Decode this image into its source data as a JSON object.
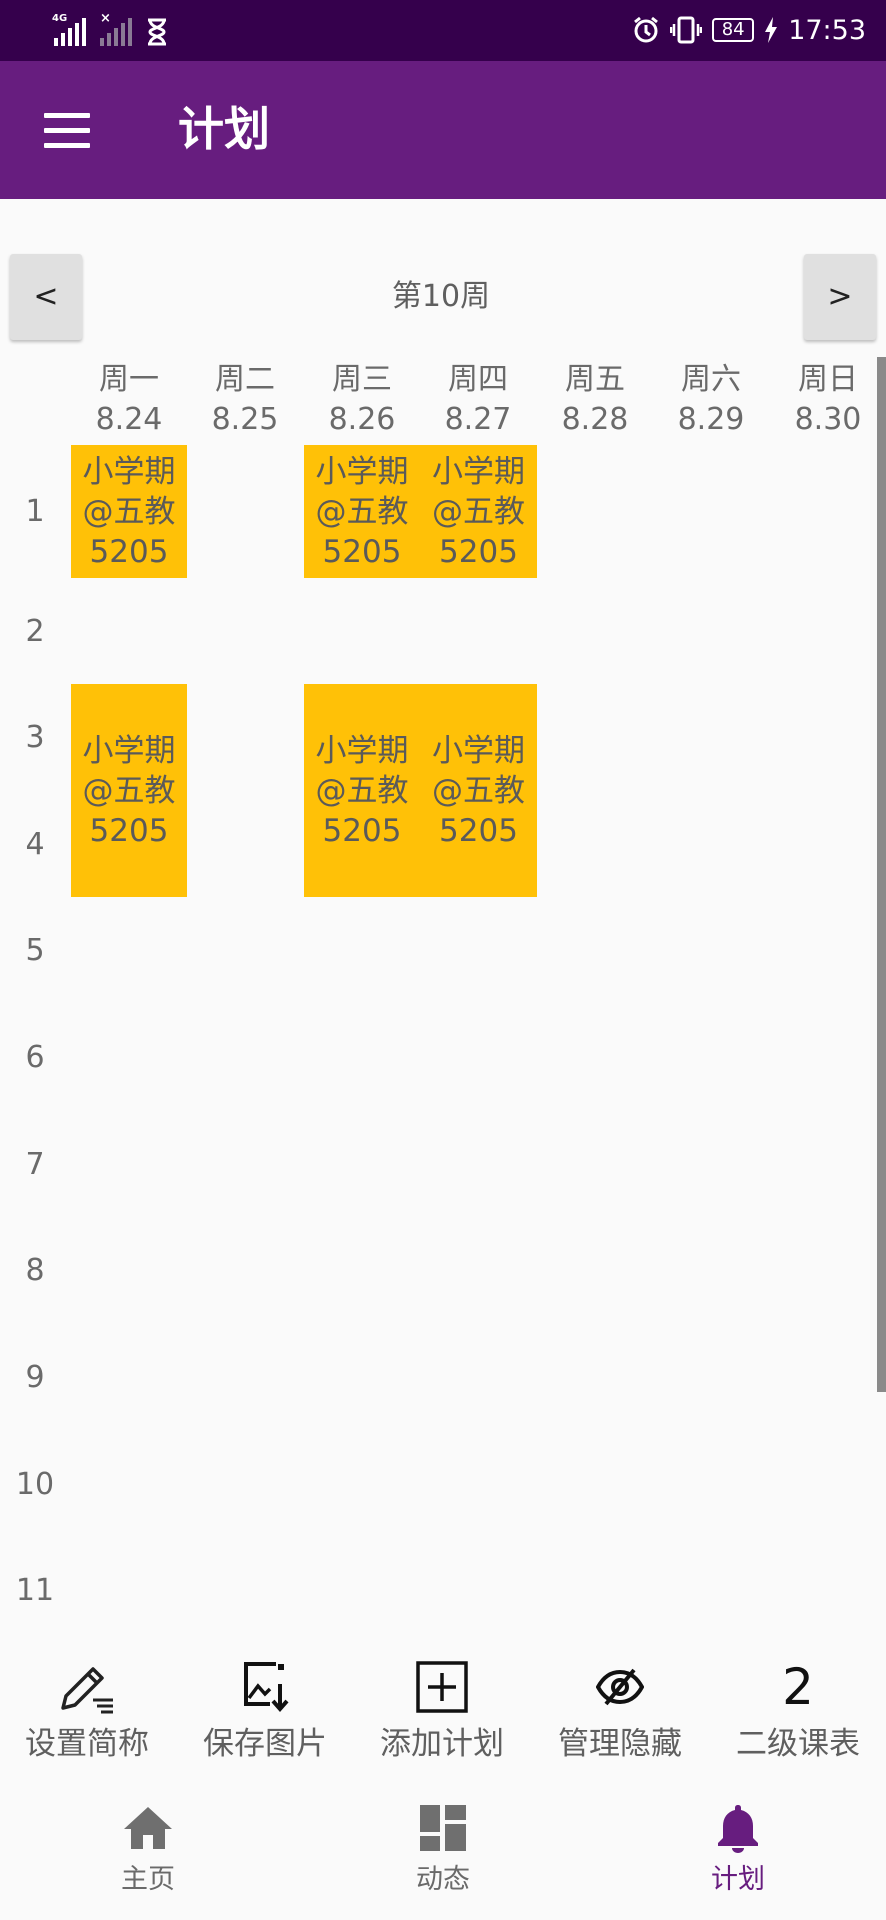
{
  "status_bar": {
    "network_tag": "4G",
    "time": "17:53",
    "battery": "84"
  },
  "app_bar": {
    "title": "计划"
  },
  "week_nav": {
    "prev_label": "<",
    "next_label": ">",
    "week_label": "第10周"
  },
  "days": [
    {
      "weekday": "周一",
      "date": "8.24"
    },
    {
      "weekday": "周二",
      "date": "8.25"
    },
    {
      "weekday": "周三",
      "date": "8.26"
    },
    {
      "weekday": "周四",
      "date": "8.27"
    },
    {
      "weekday": "周五",
      "date": "8.28"
    },
    {
      "weekday": "周六",
      "date": "8.29"
    },
    {
      "weekday": "周日",
      "date": "8.30"
    }
  ],
  "periods": [
    "1",
    "2",
    "3",
    "4",
    "5",
    "6",
    "7",
    "8",
    "9",
    "10",
    "11"
  ],
  "courses": [
    {
      "line1": "小学期",
      "line2": "@五教",
      "line3": "5205"
    },
    {
      "line1": "小学期",
      "line2": "@五教",
      "line3": "5205"
    },
    {
      "line1": "小学期",
      "line2": "@五教",
      "line3": "5205"
    },
    {
      "line1": "小学期",
      "line2": "@五教",
      "line3": "5205"
    },
    {
      "line1": "小学期",
      "line2": "@五教",
      "line3": "5205"
    },
    {
      "line1": "小学期",
      "line2": "@五教",
      "line3": "5205"
    }
  ],
  "toolbar": [
    {
      "label": "设置简称",
      "icon": "edit-icon"
    },
    {
      "label": "保存图片",
      "icon": "save-image-icon"
    },
    {
      "label": "添加计划",
      "icon": "add-box-icon"
    },
    {
      "label": "管理隐藏",
      "icon": "visibility-off-icon"
    },
    {
      "label": "二级课表",
      "icon": "number-two-icon",
      "glyph": "2"
    }
  ],
  "bottom_nav": [
    {
      "label": "主页",
      "icon": "home-icon",
      "active": false
    },
    {
      "label": "动态",
      "icon": "dashboard-icon",
      "active": false
    },
    {
      "label": "计划",
      "icon": "bell-icon",
      "active": true
    }
  ],
  "colors": {
    "status_bar": "#35004c",
    "app_bar": "#671d7f",
    "course_block": "#ffc107",
    "active_nav": "#671d7f",
    "inactive_nav": "#6a6a6a"
  }
}
